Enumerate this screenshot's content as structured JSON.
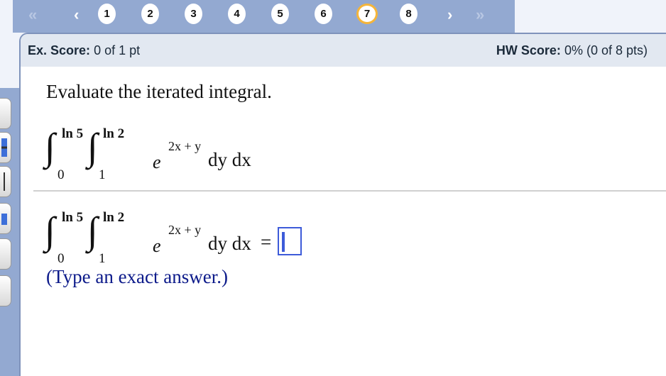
{
  "nav": {
    "first": "«",
    "prev": "‹",
    "next": "›",
    "last": "»",
    "questions": [
      "1",
      "2",
      "3",
      "4",
      "5",
      "6",
      "7",
      "8"
    ],
    "current": "7"
  },
  "score": {
    "ex_label": "Ex. Score:",
    "ex_value": "0 of 1 pt",
    "hw_label": "HW Score:",
    "hw_value": "0% (0 of 8 pts)"
  },
  "question": {
    "prompt": "Evaluate the iterated integral.",
    "outer_upper": "ln 5",
    "outer_lower": "0",
    "inner_upper": "ln 2",
    "inner_lower": "1",
    "base": "e",
    "exponent": "2x + y",
    "differentials": "dy dx",
    "equals": "=",
    "answer_value": "",
    "hint": "(Type an exact answer.)"
  }
}
